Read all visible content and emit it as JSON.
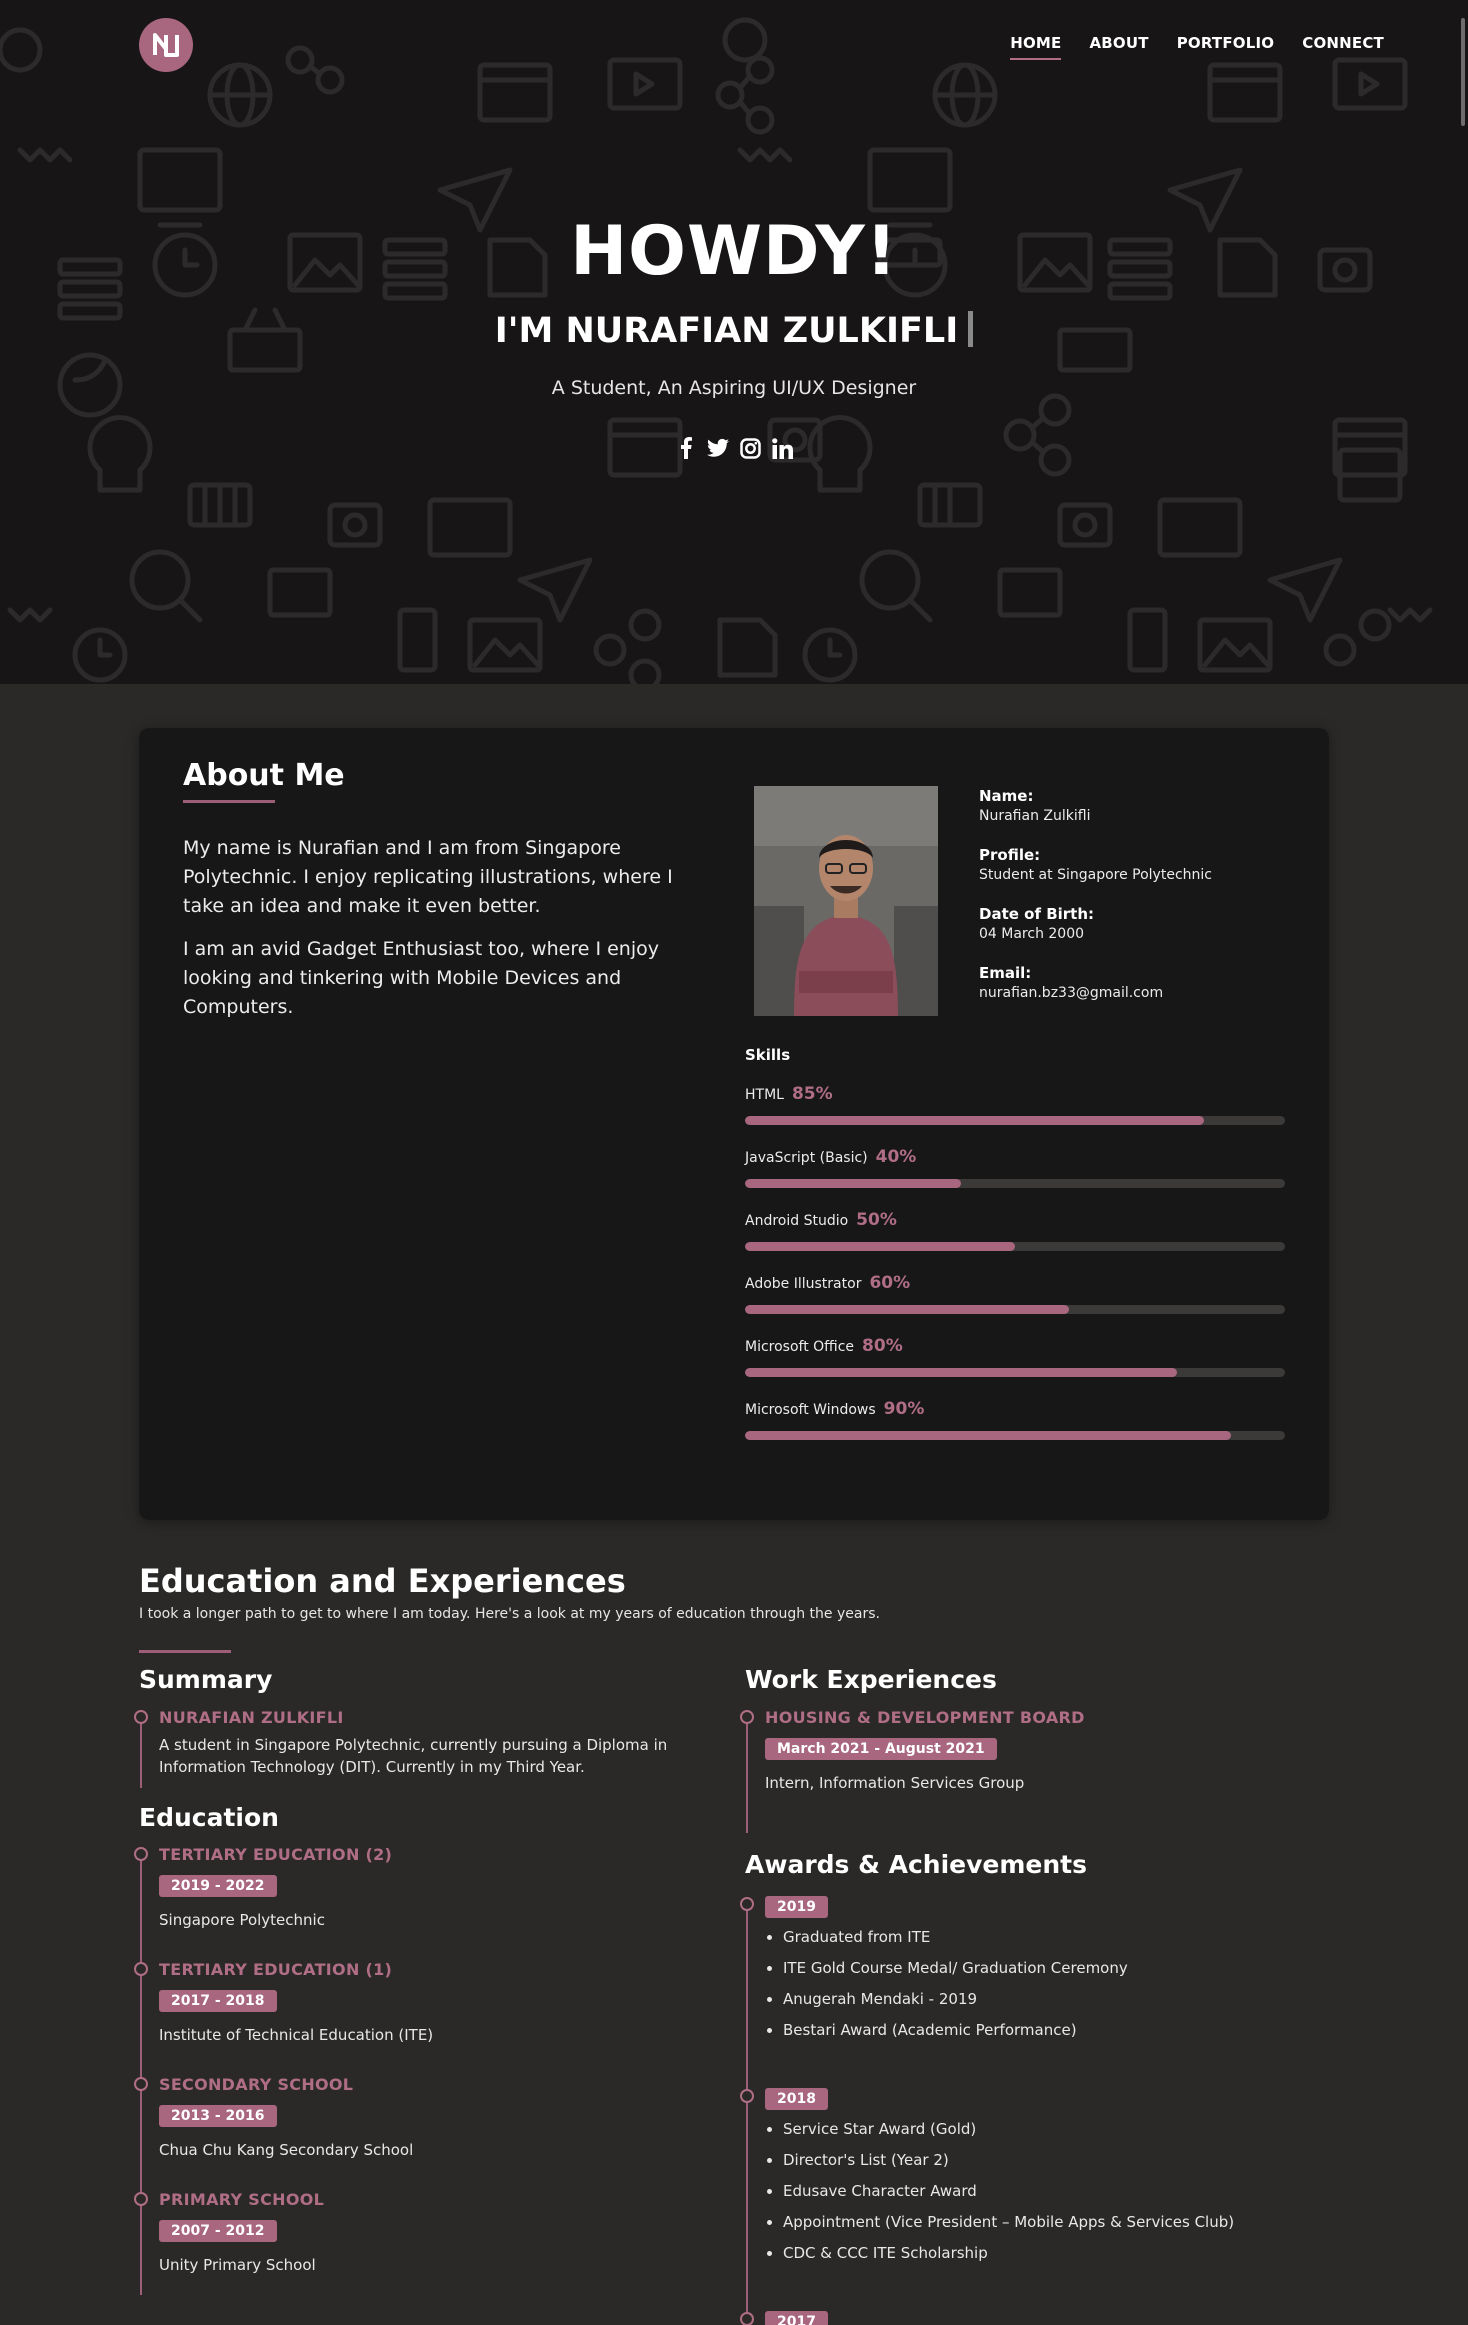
{
  "nav": {
    "items": [
      {
        "label": "HOME",
        "active": true
      },
      {
        "label": "ABOUT",
        "active": false
      },
      {
        "label": "PORTFOLIO",
        "active": false
      },
      {
        "label": "CONNECT",
        "active": false
      }
    ]
  },
  "hero": {
    "title": "HOWDY!",
    "name": "I'M NURAFIAN ZULKIFLI",
    "subtitle": "A Student, An Aspiring UI/UX Designer",
    "socials": [
      "facebook-icon",
      "twitter-icon",
      "instagram-icon",
      "linkedin-icon"
    ]
  },
  "about": {
    "title": "About Me",
    "paragraphs": [
      "My name is Nurafian and I am from Singapore Polytechnic. I enjoy replicating illustrations, where I take an idea and make it even better.",
      "I am an avid Gadget Enthusiast too, where I enjoy looking and tinkering with Mobile Devices and Computers."
    ],
    "info": [
      {
        "label": "Name:",
        "value": "Nurafian Zulkifli"
      },
      {
        "label": "Profile:",
        "value": "Student at Singapore Polytechnic"
      },
      {
        "label": "Date of Birth:",
        "value": "04 March 2000"
      },
      {
        "label": "Email:",
        "value": "nurafian.bz33@gmail.com"
      }
    ],
    "skills_title": "Skills",
    "skills": [
      {
        "name": "HTML",
        "percent_label": "85%",
        "percent": 85
      },
      {
        "name": "JavaScript (Basic)",
        "percent_label": "40%",
        "percent": 40
      },
      {
        "name": "Android Studio",
        "percent_label": "50%",
        "percent": 50
      },
      {
        "name": "Adobe Illustrator",
        "percent_label": "60%",
        "percent": 60
      },
      {
        "name": "Microsoft Office",
        "percent_label": "80%",
        "percent": 80
      },
      {
        "name": "Microsoft Windows",
        "percent_label": "90%",
        "percent": 90
      }
    ]
  },
  "education": {
    "title": "Education and Experiences",
    "subtitle": "I took a longer path to get to where I am today. Here's a look at my years of education through the years.",
    "summary": {
      "heading": "Summary",
      "name": "NURAFIAN ZULKIFLI",
      "text": "A student in Singapore Polytechnic, currently pursuing a Diploma in Information Technology (DIT). Currently in my Third Year."
    },
    "education_heading": "Education",
    "entries": [
      {
        "title": "TERTIARY EDUCATION (2)",
        "years": "2019 - 2022",
        "school": "Singapore Polytechnic"
      },
      {
        "title": "TERTIARY EDUCATION (1)",
        "years": "2017 - 2018",
        "school": "Institute of Technical Education (ITE)"
      },
      {
        "title": "SECONDARY SCHOOL",
        "years": "2013 - 2016",
        "school": "Chua Chu Kang Secondary School"
      },
      {
        "title": "PRIMARY SCHOOL",
        "years": "2007 - 2012",
        "school": "Unity Primary School"
      }
    ],
    "work_heading": "Work Experiences",
    "work": {
      "company": "HOUSING & DEVELOPMENT BOARD",
      "period": "March 2021 - August 2021",
      "role": "Intern, Information Services Group"
    },
    "awards_heading": "Awards & Achievements",
    "awards": [
      {
        "year": "2019",
        "items": [
          "Graduated from ITE",
          "ITE Gold Course Medal/ Graduation Ceremony",
          "Anugerah Mendaki - 2019",
          "Bestari Award (Academic Performance)"
        ]
      },
      {
        "year": "2018",
        "items": [
          "Service Star Award (Gold)",
          "Director's List (Year 2)",
          "Edusave Character Award",
          "Appointment (Vice President – Mobile Apps & Services Club)",
          "CDC & CCC ITE Scholarship"
        ]
      },
      {
        "year": "2017",
        "items": []
      }
    ]
  },
  "colors": {
    "accent": "#a8677f",
    "accent_text": "#b06e86",
    "card_bg": "#181718",
    "page_bg": "#2a2927",
    "hero_bg": "#171516"
  }
}
